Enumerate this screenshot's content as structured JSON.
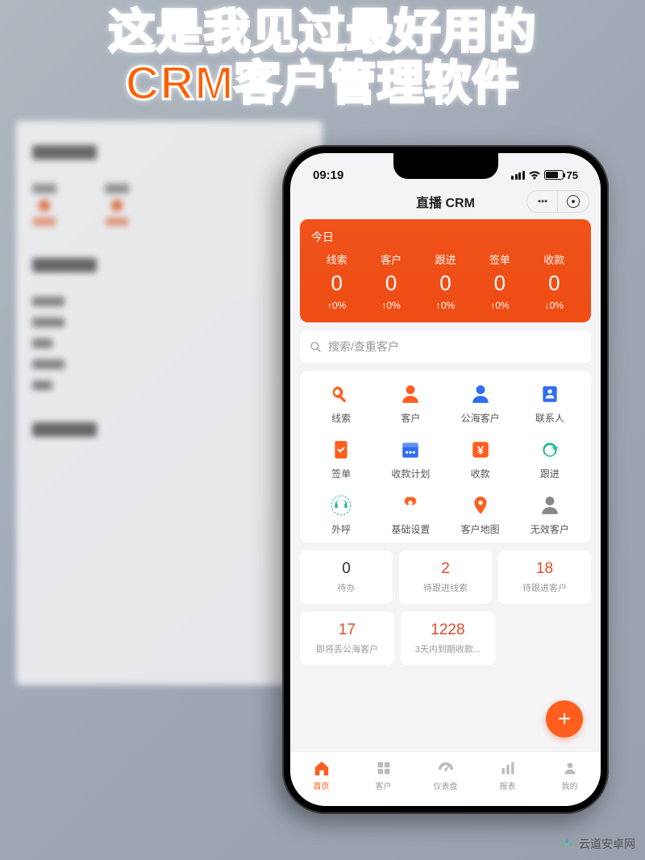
{
  "headline": "这是我见过最好用的\nCRM客户管理软件",
  "statusbar": {
    "time": "09:19",
    "battery": "75",
    "battery_fill_pct": 75
  },
  "app_header": {
    "title": "直播 CRM",
    "more_label": "···"
  },
  "today": {
    "label": "今日",
    "stats": [
      {
        "name": "线索",
        "value": "0",
        "delta": "↑0%"
      },
      {
        "name": "客户",
        "value": "0",
        "delta": "↑0%"
      },
      {
        "name": "跟进",
        "value": "0",
        "delta": "↑0%"
      },
      {
        "name": "签单",
        "value": "0",
        "delta": "↑0%"
      },
      {
        "name": "收款",
        "value": "0",
        "delta": "↓0%"
      }
    ]
  },
  "search": {
    "placeholder": "搜索/查重客户"
  },
  "grid": [
    {
      "key": "leads",
      "label": "线索",
      "color": "#ff5e1f",
      "icon": "leads"
    },
    {
      "key": "customer",
      "label": "客户",
      "color": "#ff5e1f",
      "icon": "person-solid"
    },
    {
      "key": "pool",
      "label": "公海客户",
      "color": "#2f6df1",
      "icon": "person-solid"
    },
    {
      "key": "contact",
      "label": "联系人",
      "color": "#2f6df1",
      "icon": "contact"
    },
    {
      "key": "contract",
      "label": "签单",
      "color": "#ff5e1f",
      "icon": "doc-check"
    },
    {
      "key": "payplan",
      "label": "收款计划",
      "color": "#2f6df1",
      "icon": "calendar"
    },
    {
      "key": "payment",
      "label": "收款",
      "color": "#ff5e1f",
      "icon": "yen"
    },
    {
      "key": "follow",
      "label": "跟进",
      "color": "#1fb89a",
      "icon": "refresh"
    },
    {
      "key": "call",
      "label": "外呼",
      "color": "#1fb89a",
      "icon": "headset"
    },
    {
      "key": "settings",
      "label": "基础设置",
      "color": "#ff5e1f",
      "icon": "gear"
    },
    {
      "key": "map",
      "label": "客户地图",
      "color": "#ff5e1f",
      "icon": "pin"
    },
    {
      "key": "invalid",
      "label": "无效客户",
      "color": "#888888",
      "icon": "person-solid"
    }
  ],
  "tiles": [
    {
      "value": "0",
      "label": "待办",
      "color": "normal"
    },
    {
      "value": "2",
      "label": "待跟进线索",
      "color": "red"
    },
    {
      "value": "18",
      "label": "待跟进客户",
      "color": "red"
    },
    {
      "value": "17",
      "label": "即将丢公海客户",
      "color": "red"
    },
    {
      "value": "1228",
      "label": "3天内到期收款...",
      "color": "red"
    }
  ],
  "fab": {
    "label": "+"
  },
  "tabs": [
    {
      "key": "home",
      "label": "首页",
      "icon": "home",
      "active": true
    },
    {
      "key": "customers",
      "label": "客户",
      "icon": "grid4",
      "active": false
    },
    {
      "key": "dashboard",
      "label": "仪表盘",
      "icon": "gauge",
      "active": false
    },
    {
      "key": "reports",
      "label": "报表",
      "icon": "barchart",
      "active": false
    },
    {
      "key": "me",
      "label": "我的",
      "icon": "user",
      "active": false
    }
  ],
  "watermark": {
    "text": "云道安卓网"
  }
}
